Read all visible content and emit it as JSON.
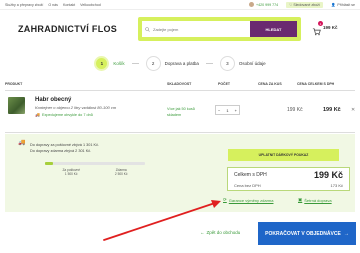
{
  "topbar": {
    "links": [
      "Služby a přepravy zboží",
      "O nás",
      "Kontakt",
      "Velkoobchod"
    ],
    "phone": "+420 999 774",
    "favorites": "Sledované zboží",
    "login": "Přihlásit se"
  },
  "header": {
    "logo": "ZAHRADNICTVÍ FLOS",
    "search_placeholder": "Zadejte pojem",
    "search_button": "HLEDAT",
    "cart_count": "1",
    "cart_price": "199 Kč"
  },
  "steps": [
    {
      "num": "1",
      "label": "Košík"
    },
    {
      "num": "2",
      "label": "Doprava a platba"
    },
    {
      "num": "3",
      "label": "Osobní údaje"
    }
  ],
  "table": {
    "headers": {
      "product": "PRODUKT",
      "stock": "SKLADOVOST",
      "qty": "POČET",
      "price": "CENA ZA KUS",
      "total": "CENA CELKEM S DPH"
    },
    "row": {
      "name": "Habr obecný",
      "description": "Kontejner o objemu 2 litry vzdálost 80-100 cm",
      "shipping": "Expedujeme obvykle do 7 dnů",
      "stock": "Více jak 50 kusů skladem",
      "qty": "1",
      "price": "199 Kč",
      "total": "199 Kč"
    }
  },
  "summary": {
    "free_shipping_1": "Do dopravy za poštovné zbývá 1 301 Kč.",
    "free_shipping_2": "Do dopravy zdarma zbývá 2 301 Kč.",
    "threshold_1_label": "Za poštovné",
    "threshold_1_value": "1 500 Kč",
    "threshold_2_label": "Zdarma",
    "threshold_2_value": "2 500 Kč",
    "progress_fraction": 0.08,
    "voucher_button": "UPLATNIT DÁRKOVÝ POUKAZ",
    "total_label": "Celkem s DPH",
    "total_value": "199 Kč",
    "net_label": "Cena bez DPH",
    "net_value": "173 Kč",
    "guarantee": "Garance výměny zdarma",
    "safe_shipping": "Šetrná doprava"
  },
  "footer": {
    "back": "Zpět do obchodu",
    "continue": "POKRAČOVAT V OBJEDNÁVCE"
  },
  "colors": {
    "accent_green": "#d6f05d",
    "text_green": "#3a9a3a",
    "search_button": "#6a2a70",
    "continue_button": "#1f66c8",
    "arrow": "#e02020"
  }
}
